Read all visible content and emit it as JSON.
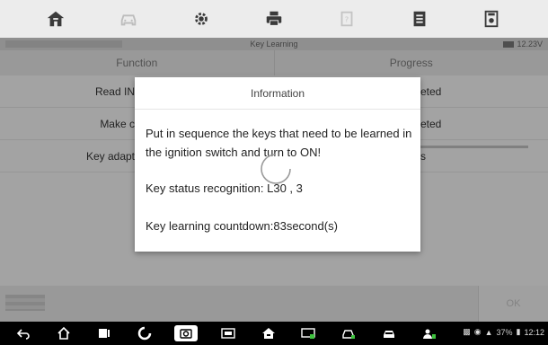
{
  "toolbar": {
    "icons": [
      "home-icon",
      "vehicle-icon",
      "settings-icon",
      "print-icon",
      "help-icon",
      "data-manager-icon",
      "save-icon"
    ]
  },
  "title_strip": {
    "title": "Key Learning",
    "voltage": "12.23V"
  },
  "table": {
    "headers": {
      "function": "Function",
      "progress": "Progress"
    },
    "rows": [
      {
        "function": "Read IN",
        "progress": "eted"
      },
      {
        "function": "Make c",
        "progress": "eted"
      },
      {
        "function": "Key adapt",
        "progress": "s"
      }
    ]
  },
  "bottom": {
    "ok_label": "OK"
  },
  "dialog": {
    "title": "Information",
    "message": "Put in sequence the keys that need to be learned in the ignition switch and turn to ON!",
    "status": "Key status recognition: L30 , 3",
    "countdown": "Key learning countdown:83second(s)"
  },
  "navbar": {
    "icons": [
      "back-icon",
      "home-icon",
      "recents-icon",
      "browser-icon",
      "camera-icon",
      "display-icon",
      "autel-home-icon",
      "vci-icon",
      "car-service-icon",
      "car-icon",
      "user-icon"
    ],
    "battery_pct": "37%",
    "time": "12:12"
  },
  "colors": {
    "overlay": "#00000055",
    "dialog_bg": "#ffffff"
  }
}
